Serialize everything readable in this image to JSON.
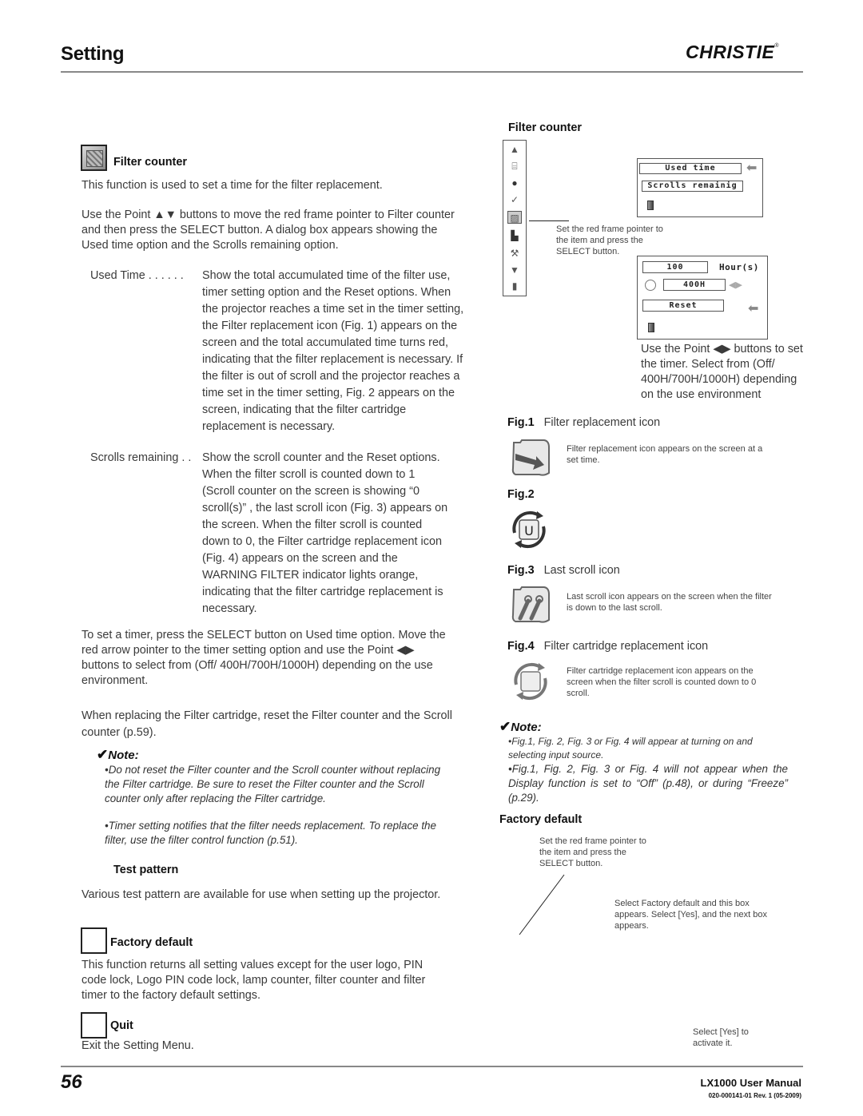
{
  "header": {
    "title": "Setting",
    "brand": "CHRISTIE",
    "brand_mark": "®"
  },
  "left": {
    "filter_counter": {
      "heading": "Filter counter",
      "intro": "This function is used to set a time for the filter replacement.",
      "instructions": "Use the Point ▲▼ buttons to move the red frame pointer to Filter counter and then press the SELECT button. A dialog box appears showing the Used time option and the Scrolls remaining option.",
      "definitions": [
        {
          "term": "Used Time . . . . . .",
          "desc": "Show the total accumulated time of the filter use, timer setting option and the Reset options. When the projector reaches a time set in the timer setting, the Filter replacement icon (Fig. 1) appears on the screen and the total accumulated time turns red, indicating that the filter replacement is necessary. If the filter is out of scroll and the projector reaches a time set in the timer setting, Fig. 2 appears on the screen, indicating that the filter cartridge replacement is necessary."
        },
        {
          "term": "Scrolls remaining . .",
          "desc": "Show the scroll counter and the Reset options. When the filter scroll is counted down to 1 (Scroll counter on the screen is showing “0 scroll(s)” , the last scroll icon (Fig. 3) appears on the screen. When the filter scroll is counted down to 0, the Filter cartridge replacement icon (Fig. 4) appears on the screen and the WARNING FILTER indicator lights orange, indicating that the filter cartridge replacement is necessary."
        }
      ],
      "timer_text": "To set a timer, press the SELECT button on Used time option. Move the red arrow pointer to the timer setting option and use the Point ◀▶ buttons to select from (Off/ 400H/700H/1000H) depending on the use environment.",
      "reset_text": "When replacing the Filter cartridge, reset the Filter counter and the Scroll counter (p.59)."
    },
    "note": {
      "title": "Note:",
      "items": [
        "•Do not reset the Filter counter and the Scroll counter without replacing the Filter cartridge.  Be sure to reset the Filter counter and the Scroll counter only after replacing the Filter cartridge.",
        "•Timer setting notifies that the filter needs replacement. To replace the filter, use the filter control function (p.51)."
      ]
    },
    "test_pattern": {
      "heading": "Test pattern",
      "text": "Various test pattern are available for use when setting up the projector."
    },
    "factory_default": {
      "heading": "Factory default",
      "text": "This function returns all setting values except for the user logo, PIN code lock, Logo PIN code lock, lamp counter, filter counter and filter timer to the factory default settings."
    },
    "quit": {
      "heading": "Quit",
      "text": "Exit the Setting Menu."
    }
  },
  "right": {
    "filter_counter_heading": "Filter counter",
    "menu_icons": [
      "up-arrow",
      "projector",
      "color-wheel",
      "pencil-check",
      "filter-counter",
      "test-pattern",
      "factory-default",
      "down-arrow",
      "exit-door"
    ],
    "dialog1": {
      "options": [
        "Used time",
        "Scrolls remainig"
      ]
    },
    "callout_select": "Set the red frame pointer to the item and press the SELECT button.",
    "dialog2": {
      "hours_value": "100",
      "hours_unit": "Hour(s)",
      "timer_value": "400H",
      "reset_label": "Reset"
    },
    "timer_help": "Use the Point ◀▶ buttons to set the timer. Select from (Off/ 400H/700H/1000H) depending on the use environment",
    "figures": [
      {
        "num": "Fig.1",
        "label": "Filter replacement icon",
        "desc": "Filter replacement icon appears on the screen at a set time."
      },
      {
        "num": "Fig.2",
        "label": "",
        "desc": ""
      },
      {
        "num": "Fig.3",
        "label": "Last scroll icon",
        "desc": "Last scroll icon appears on the screen when the filter is down to the last scroll."
      },
      {
        "num": "Fig.4",
        "label": "Filter cartridge replacement icon",
        "desc": "Filter cartridge replacement icon appears on the screen when the filter scroll is counted down to 0 scroll."
      }
    ],
    "note": {
      "title": "Note:",
      "items": [
        "•Fig.1, Fig. 2, Fig. 3 or Fig. 4 will appear at turning on and selecting input source.",
        "•Fig.1, Fig. 2, Fig. 3 or Fig. 4 will not appear when the Display function is set to “Off” (p.48), or during “Freeze” (p.29)."
      ]
    },
    "factory_default": {
      "heading": "Factory default",
      "callout_select": "Set the red frame pointer to the item and press the SELECT button.",
      "callout_box": "Select Factory default and this box appears. Select [Yes], and the next box appears.",
      "callout_yes": "Select [Yes] to activate it."
    }
  },
  "footer": {
    "page_number": "56",
    "manual_title": "LX1000 User Manual",
    "revision": "020-000141-01  Rev. 1  (05-2009)"
  }
}
